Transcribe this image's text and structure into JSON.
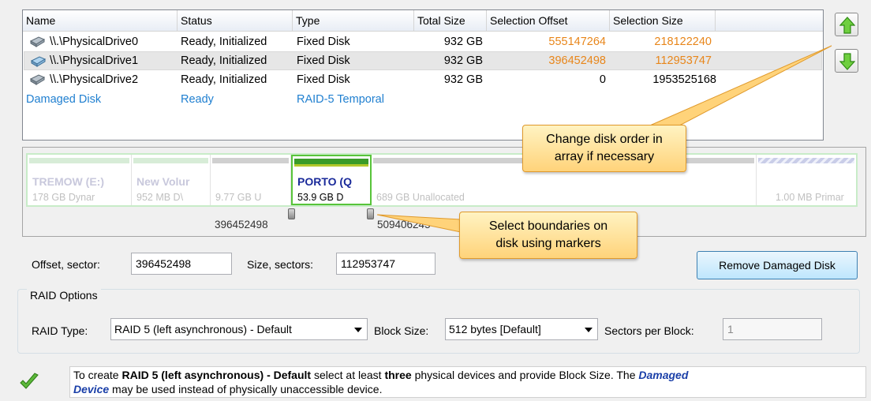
{
  "table": {
    "headers": [
      "Name",
      "Status",
      "Type",
      "Total Size",
      "Selection Offset",
      "Selection Size"
    ],
    "rows": [
      {
        "name": "\\\\.\\PhysicalDrive0",
        "status": "Ready, Initialized",
        "type": "Fixed Disk",
        "total": "932 GB",
        "offset": "555147264",
        "size": "218122240",
        "icon": "hard-disk-icon"
      },
      {
        "name": "\\\\.\\PhysicalDrive1",
        "status": "Ready, Initialized",
        "type": "Fixed Disk",
        "total": "932 GB",
        "offset": "396452498",
        "size": "112953747",
        "icon": "hard-disk-icon"
      },
      {
        "name": "\\\\.\\PhysicalDrive2",
        "status": "Ready, Initialized",
        "type": "Fixed Disk",
        "total": "932 GB",
        "offset": "0",
        "size": "1953525168",
        "icon": "hard-disk-icon"
      },
      {
        "name": "Damaged Disk",
        "status": "Ready",
        "type": "RAID-5 Temporal"
      }
    ]
  },
  "buttons": {
    "up_icon": "arrow-up-icon",
    "down_icon": "arrow-down-icon",
    "remove": "Remove Damaged Disk"
  },
  "partitions": [
    {
      "name": "TREMOW (E:)",
      "sub": "178 GB Dynar",
      "color": "#d7ecd7"
    },
    {
      "name": "New Volur",
      "sub": "952 MB D\\",
      "color": "#d7ecd7"
    },
    {
      "name": "",
      "sub": "9.77 GB U",
      "color": "#d0d0d0"
    },
    {
      "name": "PORTO (Q",
      "sub": "53.9 GB D",
      "color": "#3a9b28"
    },
    {
      "name": "",
      "sub": "689 GB  Unallocated",
      "color": "#d0d0d0"
    },
    {
      "name": "",
      "sub": "1.00 MB Primar",
      "color": "#c9cde8"
    }
  ],
  "markers": {
    "left": "396452498",
    "right": "509406245"
  },
  "callouts": {
    "order": [
      "Change disk order in",
      "array if necessary"
    ],
    "bounds": [
      "Select boundaries on",
      "disk using markers"
    ]
  },
  "form": {
    "offset_label": "Offset, sector:",
    "offset_value": "396452498",
    "size_label": "Size, sectors:",
    "size_value": "112953747",
    "group_title": "RAID Options",
    "raid_type_label": "RAID Type:",
    "raid_type_value": "RAID 5 (left asynchronous) - Default",
    "block_label": "Block Size:",
    "block_value": "512 bytes [Default]",
    "spb_label": "Sectors per Block:",
    "spb_value": "1"
  },
  "info": {
    "p1": "To create ",
    "b1": "RAID 5 (left asynchronous) - Default",
    "p2": " select at least ",
    "b2": "three",
    "p3": " physical devices and provide Block Size. The ",
    "dev1": "Damaged",
    "dev2": "Device",
    "p4": " may be used instead of physically unaccessible device.",
    "icon": "check-icon"
  },
  "colors": {
    "orange": "#e8861a",
    "link_blue": "#1f7fd0",
    "callout": "#ffd37a"
  }
}
